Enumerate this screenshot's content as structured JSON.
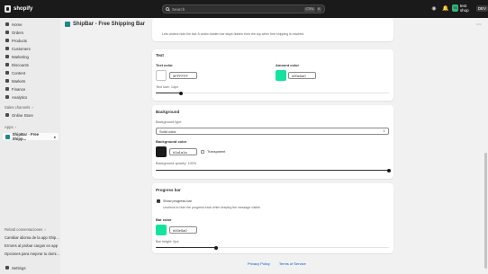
{
  "topbar": {
    "brand": "shopify",
    "search_placeholder": "Search",
    "shortcut_keys": [
      "CTRL",
      "K"
    ],
    "store_initials": "TS",
    "store_name": "test shop",
    "store_badge": "DEV"
  },
  "sidebar": {
    "items": [
      {
        "label": "Home"
      },
      {
        "label": "Orders"
      },
      {
        "label": "Products"
      },
      {
        "label": "Customers"
      },
      {
        "label": "Marketing"
      },
      {
        "label": "Discounts"
      },
      {
        "label": "Content"
      },
      {
        "label": "Markets"
      },
      {
        "label": "Finance"
      },
      {
        "label": "Analytics"
      }
    ],
    "sales_channels_label": "Sales channels",
    "online_store_label": "Online Store",
    "apps_label": "Apps",
    "app_item_label": "ShipBar - Free Shipp...",
    "recent_label": "Relatd conversaciones",
    "recent_items": [
      "Cambiar idioma de la app Ship...",
      "Errores al probar cargos en app",
      "Opciones para mejorar tu domi..."
    ],
    "settings_label": "Settings"
  },
  "page": {
    "title": "ShipBar - Free Shipping Bar",
    "top_hint": "Lets visitors hide the bar. A visitor-hidden bar stays hidden from the top when free shipping is reached."
  },
  "text_card": {
    "title": "Text",
    "text_color_label": "Text color",
    "text_color_value": "#FFFFFF",
    "text_color_hex": "#FFFFFF",
    "amount_color_label": "Amount color",
    "amount_color_value": "#00e5a0",
    "amount_color_hex": "#14e3a0",
    "text_size_label": "Text size: 14px",
    "text_size_fraction": 0.11
  },
  "background_card": {
    "title": "Background",
    "type_label": "Background type",
    "type_value": "Solid color",
    "color_label": "Background color",
    "color_value": "#1a1a1a",
    "color_hex": "#1a1a1a",
    "transparent_label": "Transparent",
    "opacity_label": "Background opacity: 100%",
    "opacity_fraction": 1.0
  },
  "progress_card": {
    "title": "Progress bar",
    "show_label": "Show progress bar",
    "show_hint": "Uncheck to hide the progress track while keeping the message visible.",
    "bar_color_label": "Bar color",
    "bar_color_value": "#00e5a0",
    "bar_color_hex": "#14e3a0",
    "bar_height_label": "Bar height: 6px",
    "bar_height_fraction": 0.26
  },
  "footer": {
    "privacy": "Privacy Policy",
    "terms": "Terms of Service"
  }
}
